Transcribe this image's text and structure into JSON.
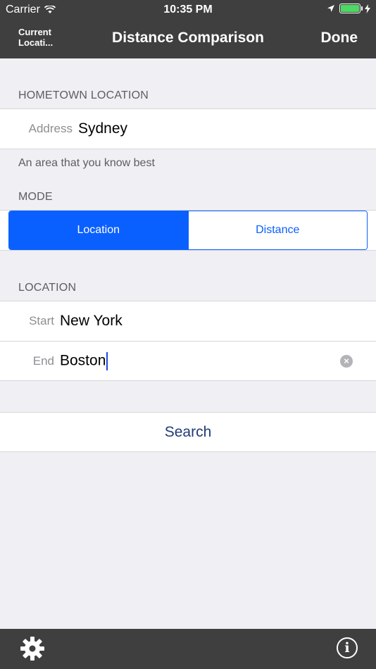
{
  "status": {
    "carrier": "Carrier",
    "time": "10:35 PM"
  },
  "nav": {
    "left_line1": "Current",
    "left_line2": "Locati...",
    "title": "Distance Comparison",
    "done": "Done"
  },
  "hometown": {
    "header": "HOMETOWN LOCATION",
    "address_label": "Address",
    "address_value": "Sydney",
    "footer": "An area that you know best"
  },
  "mode": {
    "header": "MODE",
    "options": [
      "Location",
      "Distance"
    ],
    "selected": "Location"
  },
  "location": {
    "header": "LOCATION",
    "start_label": "Start",
    "start_value": "New York",
    "end_label": "End",
    "end_value": "Boston"
  },
  "search": {
    "label": "Search"
  },
  "colors": {
    "accent": "#0a60ff",
    "bar": "#3f3f3f",
    "battery": "#4cd964"
  },
  "icons": {
    "settings": "gear-icon",
    "info": "info-icon",
    "clear": "clear-icon"
  }
}
